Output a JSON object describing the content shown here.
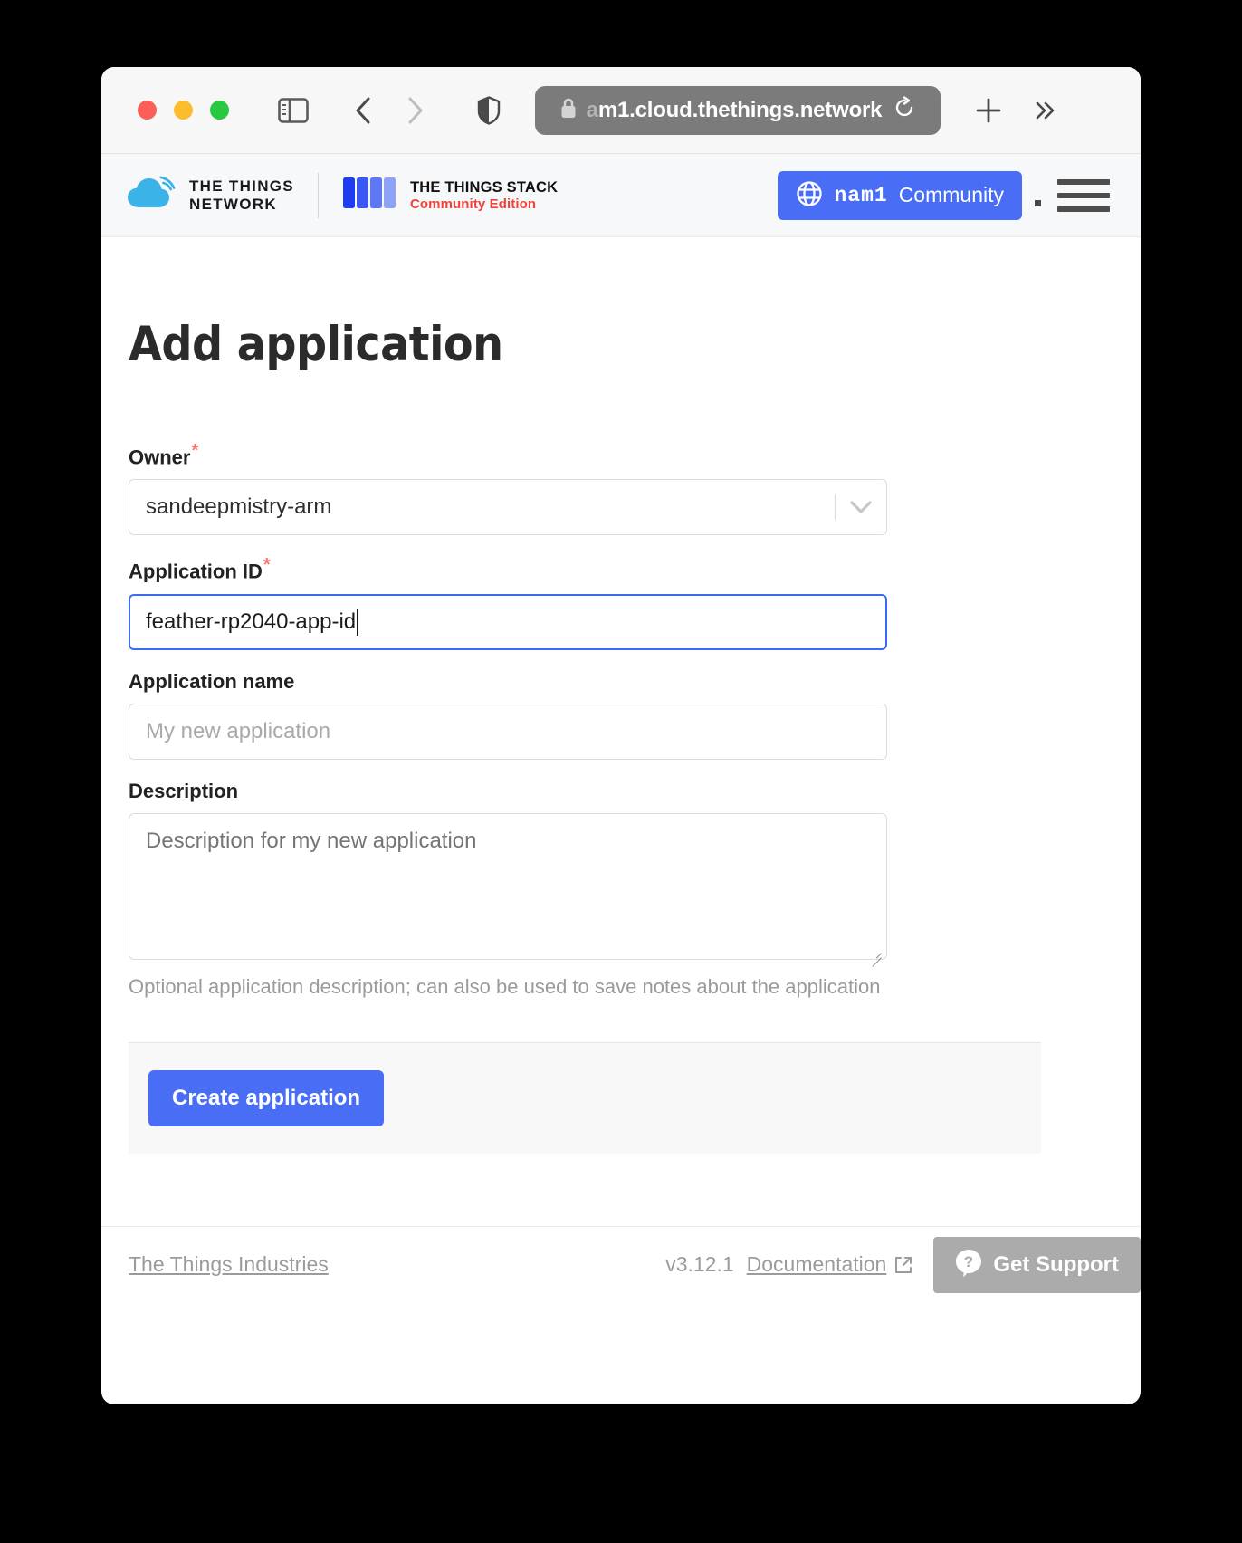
{
  "browser": {
    "url_prefix_faded": "a",
    "url_text": "m1.cloud.thethings.network",
    "lock_icon": "lock-icon",
    "reload_icon": "reload-icon",
    "back_icon": "chevron-left-icon",
    "forward_icon": "chevron-right-icon",
    "sidebar_icon": "sidebar-toggle-icon",
    "shield_icon": "shield-icon",
    "new_tab_icon": "plus-icon",
    "more_icon": "double-chevron-right-icon"
  },
  "header": {
    "brand_line1": "THE THINGS",
    "brand_line2": "NETWORK",
    "stack_title": "THE THINGS STACK",
    "stack_subtitle": "Community Edition",
    "cluster_name": "nam1",
    "cluster_label": "Community",
    "globe_icon": "globe-icon",
    "menu_icon": "hamburger-menu-icon",
    "accent_blue": "#4a6df5",
    "accent_red": "#f5413a"
  },
  "page": {
    "title": "Add application"
  },
  "form": {
    "owner": {
      "label": "Owner",
      "required_mark": "*",
      "value": "sandeepmistry-arm",
      "chevron_icon": "chevron-down-icon"
    },
    "application_id": {
      "label": "Application ID",
      "required_mark": "*",
      "value": "feather-rp2040-app-id",
      "focused": true
    },
    "application_name": {
      "label": "Application name",
      "placeholder": "My new application",
      "value": ""
    },
    "description": {
      "label": "Description",
      "placeholder": "Description for my new application",
      "value": "",
      "help_text": "Optional application description; can also be used to save notes about the application"
    },
    "submit_label": "Create application"
  },
  "footer": {
    "company_link": "The Things Industries",
    "version": "v3.12.1",
    "docs_link": "Documentation",
    "external_icon": "external-link-icon",
    "support_label": "Get Support",
    "support_icon": "question-mark-icon"
  }
}
